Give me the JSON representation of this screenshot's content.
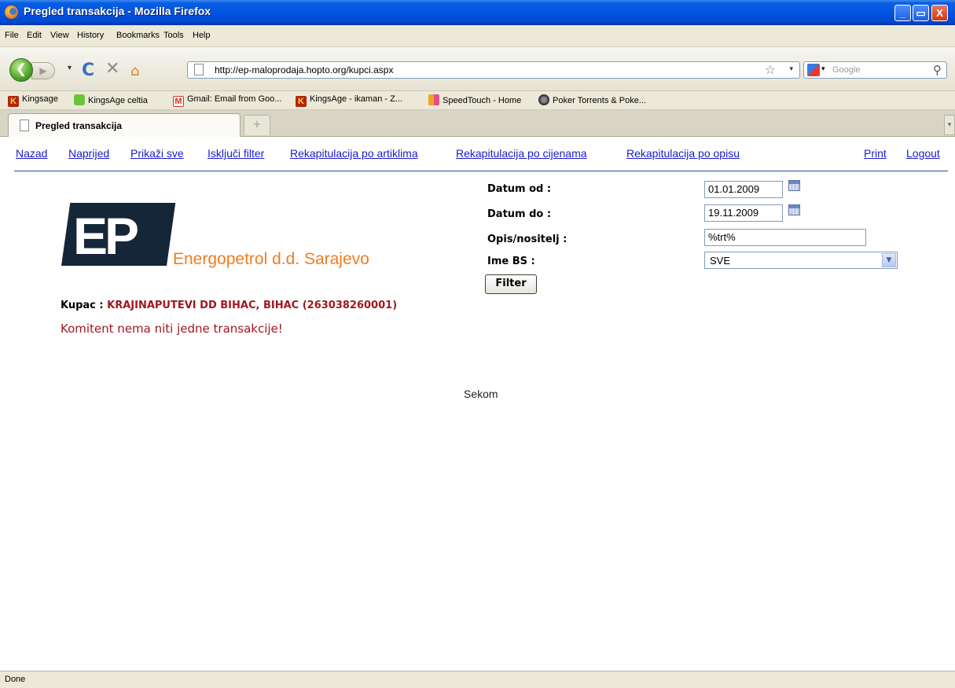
{
  "window": {
    "title": "Pregled transakcija - Mozilla Firefox",
    "controls": {
      "minimize": "_",
      "maximize": "▭",
      "close": "X"
    }
  },
  "menu": [
    "File",
    "Edit",
    "View",
    "History",
    "Bookmarks",
    "Tools",
    "Help"
  ],
  "navbar": {
    "url": "http://ep-maloprodaja.hopto.org/kupci.aspx",
    "search_placeholder": "Google"
  },
  "bookmarks": [
    {
      "label": "Kingsage",
      "icon": "kingsage-icon"
    },
    {
      "label": "KingsAge celtia",
      "icon": "chat-icon"
    },
    {
      "label": "Gmail: Email from Goo...",
      "icon": "gmail-icon"
    },
    {
      "label": "KingsAge - ikaman - Z...",
      "icon": "kingsage-icon"
    },
    {
      "label": "SpeedTouch - Home",
      "icon": "speedtouch-icon"
    },
    {
      "label": "Poker Torrents & Poke...",
      "icon": "poker-icon"
    }
  ],
  "tab": {
    "title": "Pregled transakcija"
  },
  "links": {
    "nazad": "Nazad",
    "naprijed": "Naprijed",
    "prikazi_sve": "Prikaži sve",
    "iskljuci_filter": "Isključi filter",
    "rekap_artikli": "Rekapitulacija po artiklima",
    "rekap_cijene": "Rekapitulacija po cijenama",
    "rekap_opis": "Rekapitulacija po opisu",
    "print": "Print",
    "logout": "Logout"
  },
  "logo": {
    "letters": "EP",
    "company": "Energopetrol d.d. Sarajevo"
  },
  "kupac": {
    "label": "Kupac : ",
    "value": "KRAJINAPUTEVI DD BIHAC, BIHAC (263038260001)"
  },
  "message": "Komitent nema niti jedne transakcije!",
  "filter": {
    "datum_od_label": "Datum od :",
    "datum_od_value": "01.01.2009",
    "datum_do_label": "Datum do :",
    "datum_do_value": "19.11.2009",
    "opis_label": "Opis/nositelj :",
    "opis_value": "%trt%",
    "ime_bs_label": "Ime BS :",
    "ime_bs_value": "SVE",
    "button": "Filter"
  },
  "footer": "Sekom",
  "status": "Done",
  "colors": {
    "link": "#1a1acc",
    "accent_orange": "#f07d1e",
    "error_red": "#a0171f",
    "logo_navy": "#152638"
  }
}
